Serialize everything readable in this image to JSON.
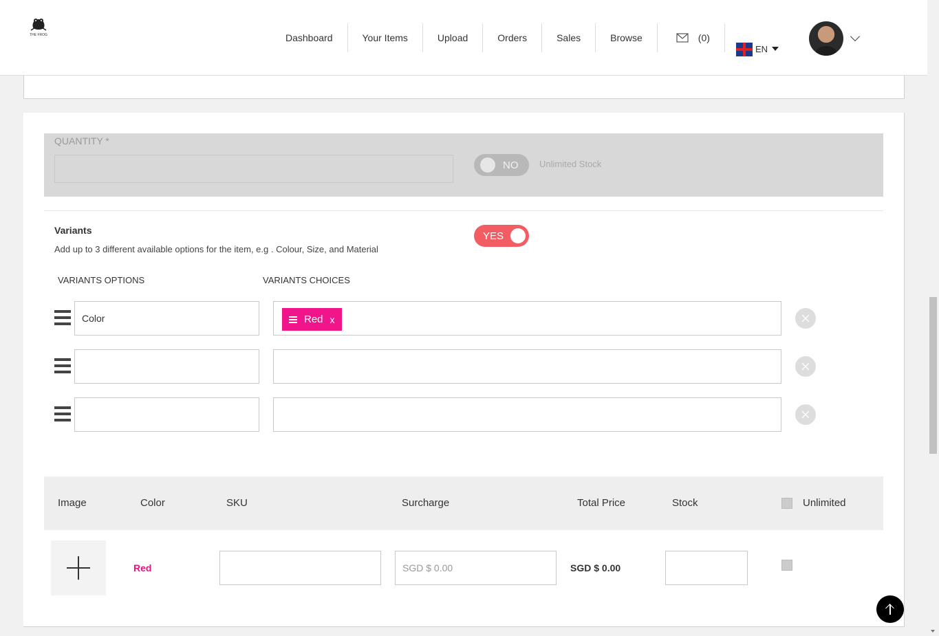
{
  "header": {
    "logo_text": "THE FROG",
    "nav": [
      "Dashboard",
      "Your Items",
      "Upload",
      "Orders",
      "Sales",
      "Browse"
    ],
    "messages_count": "(0)",
    "language": "EN"
  },
  "quantity": {
    "label": "QUANTITY *",
    "toggle_label": "NO",
    "unlimited_label": "Unlimited Stock"
  },
  "variants": {
    "title": "Variants",
    "description": "Add up to 3 different available options for the item, e.g . Colour, Size, and Material",
    "toggle_label": "YES",
    "options_header": "VARIANTS OPTIONS",
    "choices_header": "VARIANTS CHOICES",
    "rows": [
      {
        "option": "Color",
        "choices": [
          "Red"
        ]
      },
      {
        "option": "",
        "choices": []
      },
      {
        "option": "",
        "choices": []
      }
    ],
    "chip_remove": "x"
  },
  "table": {
    "headers": [
      "Image",
      "Color",
      "SKU",
      "Surcharge",
      "Total Price",
      "Stock",
      "Unlimited"
    ],
    "row": {
      "color": "Red",
      "surcharge_placeholder": "SGD $ 0.00",
      "total_price": "SGD $ 0.00"
    }
  },
  "colors": {
    "accent": "#f25d63",
    "chip": "#f0158a",
    "variant_text": "#e0177d"
  }
}
